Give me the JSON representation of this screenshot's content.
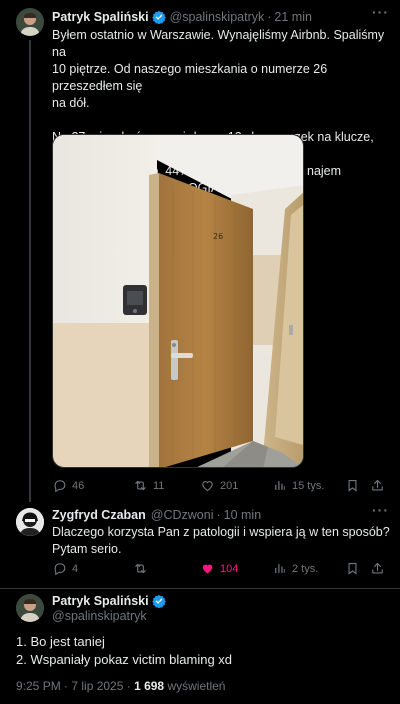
{
  "tweets": [
    {
      "author": "Patryk Spaliński",
      "handle": "@spalinskipatryk",
      "time": "21 min",
      "text_lines_1": [
        "Byłem ostatnio w Warszawie. Wynajęliśmy Airbnb. Spaliśmy na",
        "10 piętrze. Od naszego mieszkania o numerze 26 przeszedłem się",
        "na dół."
      ],
      "text_lines_2": [
        "Na 27 mieszkań zauważyłem... 12 skrzyneczek na klucze, typowa",
        "praktyka dla Airbnb. 44% mieszkań poszło na najem",
        "krótkoterminowy. PATOLOGIA."
      ],
      "photo_door_number": "26",
      "replies": "46",
      "reposts": "11",
      "likes": "201",
      "views": "15 tys."
    },
    {
      "author": "Zygfryd Czaban",
      "handle": "@CDzwoni",
      "time": "10 min",
      "text_lines": [
        "Dlaczego korzysta Pan z patologii i wspiera ją w ten sposób?",
        "Pytam serio."
      ],
      "replies": "4",
      "reposts": "",
      "likes": "104",
      "views": "2 tys."
    }
  ],
  "main_tweet": {
    "author": "Patryk Spaliński",
    "handle": "@spalinskipatryk",
    "lines": [
      "1. Bo jest taniej",
      "2. Wspaniały pokaz victim blaming xd"
    ],
    "timestamp": "9:25 PM · 7 lip 2025 ·",
    "views_count": "1 698",
    "views_label": "wyświetleń"
  },
  "colors": {
    "background": "#000000",
    "text": "#e7e9ea",
    "muted": "#71767b",
    "verified": "#1d9bf0",
    "like": "#f91880"
  },
  "icons": [
    "verified-badge-icon",
    "more-icon",
    "reply-icon",
    "repost-icon",
    "like-icon",
    "views-icon",
    "bookmark-icon",
    "share-icon"
  ]
}
